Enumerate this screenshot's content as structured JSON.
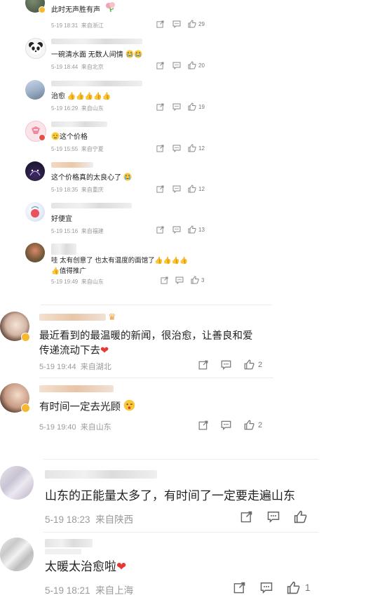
{
  "comments_small": [
    {
      "text": "此时无声胜有声",
      "time": "5-19 18:31",
      "loc": "来自浙江",
      "likes": "29"
    },
    {
      "text": "一碗清水面 无数人间情",
      "time": "5-19 18:44",
      "loc": "来自北京",
      "likes": "20"
    },
    {
      "text": "治愈",
      "time": "5-19 16:29",
      "loc": "来自山东",
      "likes": "19"
    },
    {
      "text": "这个价格",
      "time": "5-19 15:55",
      "loc": "来自宁夏",
      "likes": "12"
    },
    {
      "text": "这个价格真的太良心了",
      "time": "5-19 18:35",
      "loc": "来自重庆",
      "likes": "12"
    },
    {
      "text": "好便宜",
      "time": "5-19 15:16",
      "loc": "来自福建",
      "likes": "13"
    },
    {
      "text_line1": "哇 太有创意了 也太有温度的面馆了",
      "text_line2": "值得推广",
      "time": "5-19 19:49",
      "loc": "来自山东",
      "likes": "3"
    }
  ],
  "comments_mid": [
    {
      "text_line1": "最近看到的最温暖的新闻，很治愈，让善良和爱",
      "text_line2": "传递流动下去",
      "time": "5-19 19:44",
      "loc": "来自湖北",
      "likes": "2"
    },
    {
      "text": "有时间一定去光顾",
      "time": "5-19 19:40",
      "loc": "来自山东",
      "likes": "2"
    }
  ],
  "comments_large": [
    {
      "text": "山东的正能量太多了，有时间了一定要走遍山东",
      "time": "5-19 18:23",
      "loc": "来自陕西",
      "likes": ""
    },
    {
      "text": "太暖太治愈啦",
      "time": "5-19 18:21",
      "loc": "来自上海",
      "likes": "1"
    }
  ]
}
